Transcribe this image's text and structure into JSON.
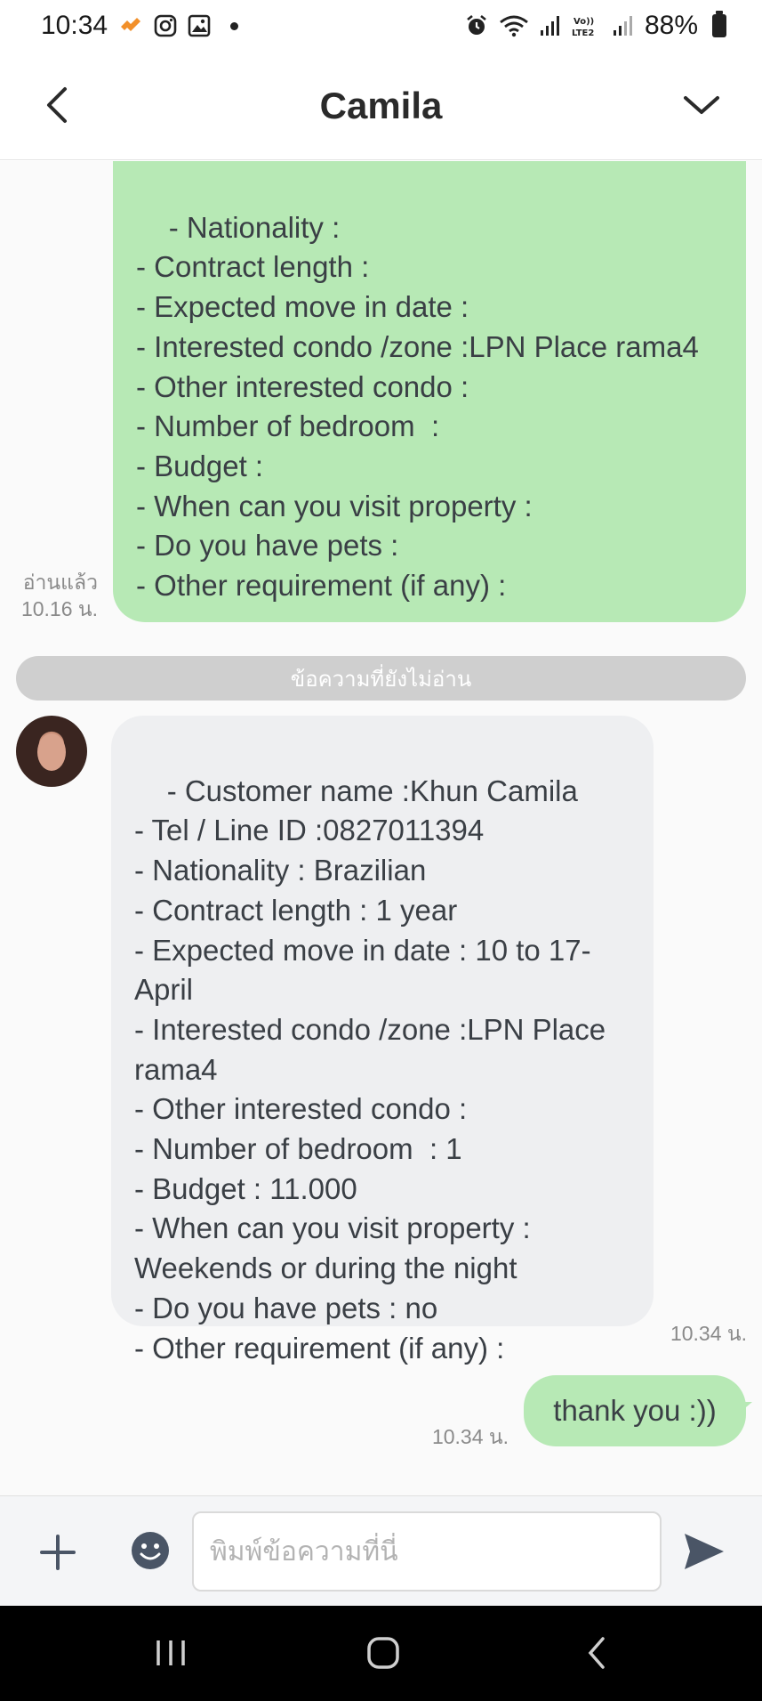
{
  "status_bar": {
    "time": "10:34",
    "battery": "88%",
    "icons": [
      "notification-app-icon",
      "instagram-icon",
      "gallery-icon",
      "dot-icon",
      "alarm-icon",
      "wifi-icon",
      "signal-icon",
      "volte-icon",
      "signal-icon-2",
      "battery-icon"
    ]
  },
  "header": {
    "title": "Camila"
  },
  "messages": {
    "sent_form": {
      "text": "- Nationality :\n- Contract length :\n- Expected move in date :\n- Interested condo /zone :LPN Place rama4\n- Other interested condo :\n- Number of bedroom  :\n- Budget :\n- When can you visit property :\n- Do you have pets :\n- Other requirement (if any) :",
      "read_label": "อ่านแล้ว",
      "time": "10.16 น."
    },
    "unread_divider": "ข้อความที่ยังไม่อ่าน",
    "received_form": {
      "text": "- Customer name :Khun Camila\n- Tel / Line ID :0827011394\n- Nationality : Brazilian\n- Contract length : 1 year\n- Expected move in date : 10 to 17-April\n- Interested condo /zone :LPN Place rama4\n- Other interested condo :\n- Number of bedroom  : 1\n- Budget : 11.000\n- When can you visit property : Weekends or during the night\n- Do you have pets : no\n- Other requirement (if any) :",
      "time": "10.34 น."
    },
    "sent_thanks": {
      "text": "thank you :))",
      "time": "10.34 น."
    }
  },
  "input_bar": {
    "placeholder": "พิมพ์ข้อความที่นี่"
  },
  "colors": {
    "sent_bubble": "#b7e9b5",
    "received_bubble": "#eeeff1",
    "divider": "#cfcfcf"
  }
}
